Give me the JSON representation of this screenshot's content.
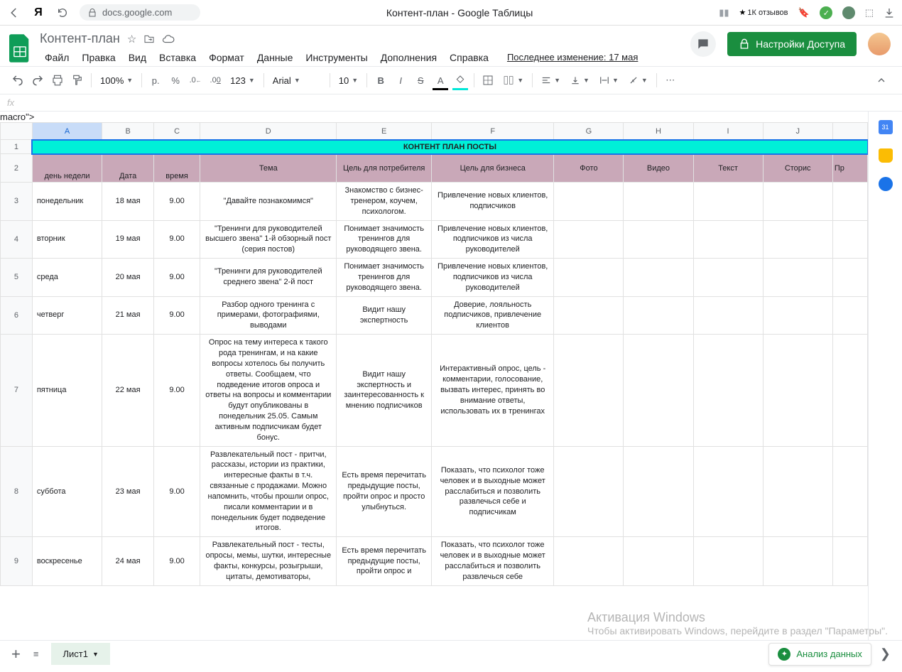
{
  "browser": {
    "url": "docs.google.com",
    "tab_title": "Контент-план - Google Таблицы",
    "reviews": "1К отзывов"
  },
  "doc": {
    "title": "Контент-план",
    "menu": [
      "Файл",
      "Правка",
      "Вид",
      "Вставка",
      "Формат",
      "Данные",
      "Инструменты",
      "Дополнения",
      "Справка"
    ],
    "last_edit": "Последнее изменение: 17 мая",
    "share_label": "Настройки Доступа"
  },
  "toolbar": {
    "zoom": "100%",
    "currency": "р.",
    "percent": "%",
    "dec_dec": ".0",
    "inc_dec": ".00",
    "numfmt": "123",
    "font": "Arial",
    "size": "10"
  },
  "fx": "fx",
  "columns": [
    "A",
    "B",
    "C",
    "D",
    "E",
    "F",
    "G",
    "H",
    "I",
    "J"
  ],
  "extra_col": "Пр",
  "title_row": "КОНТЕНТ ПЛАН ПОСТЫ",
  "headers": [
    "день недели",
    "Дата",
    "время",
    "Тема",
    "Цель для потребителя",
    "Цель для бизнеса",
    "Фото",
    "Видео",
    "Текст",
    "Сторис"
  ],
  "rows": [
    {
      "num": 3,
      "cells": [
        "понедельник",
        "18 мая",
        "9.00",
        "\"Давайте познакомимся\"",
        "Знакомство с бизнес-тренером, коучем, психологом.",
        "Привлечение новых клиентов, подписчиков",
        "",
        "",
        "",
        ""
      ]
    },
    {
      "num": 4,
      "cells": [
        "вторник",
        "19 мая",
        "9.00",
        "\"Тренинги для руководителей высшего звена\" 1-й обзорный пост (серия постов)",
        "Понимает значимость тренингов для руководящего звена.",
        "Привлечение новых клиентов, подписчиков из числа руководителей",
        "",
        "",
        "",
        ""
      ]
    },
    {
      "num": 5,
      "cells": [
        "среда",
        "20 мая",
        "9.00",
        "\"Тренинги для руководителей среднего звена\" 2-й пост",
        "Понимает значимость тренингов для руководящего звена.",
        "Привлечение новых клиентов, подписчиков из числа руководителей",
        "",
        "",
        "",
        ""
      ]
    },
    {
      "num": 6,
      "cells": [
        "четверг",
        "21 мая",
        "9.00",
        "Разбор одного тренинга с примерами, фотографиями, выводами",
        "Видит нашу экспертность",
        "Доверие, лояльность подписчиков, привлечение клиентов",
        "",
        "",
        "",
        ""
      ]
    },
    {
      "num": 7,
      "cells": [
        "пятница",
        "22 мая",
        "9.00",
        "Опрос на тему интереса к такого рода тренингам, и на какие вопросы хотелось бы получить ответы.  Сообщаем, что подведение итогов опроса и ответы на вопросы и комментарии будут опубликованы в понедельник 25.05. Самым активным подписчикам будет бонус.",
        "Видит нашу экспертность и заинтересованность к мнению подписчиков",
        "Интерактивный опрос, цель - комментарии, голосование, вызвать интерес, принять во внимание ответы, использовать их в тренингах",
        "",
        "",
        "",
        ""
      ]
    },
    {
      "num": 8,
      "cells": [
        "суббота",
        "23 мая",
        "9.00",
        "Развлекательный пост - притчи, рассказы, истории из практики, интересные факты в т.ч. связанные с продажами. Можно напомнить, чтобы прошли опрос, писали комментарии и в понедельник будет подведение итогов.",
        "Есть время перечитать предыдущие посты, пройти опрос и просто улыбнуться.",
        "Показать, что психолог тоже человек и в выходные может расслабиться и позволить развлечься себе и подписчикам",
        "",
        "",
        "",
        ""
      ]
    },
    {
      "num": 9,
      "cells": [
        "воскресенье",
        "24 мая",
        "9.00",
        "Развлекательный пост - тесты, опросы, мемы, шутки, интересные факты, конкурсы, розыгрыши, цитаты, демотиваторы,",
        "Есть время перечитать предыдущие посты, пройти опрос и",
        "Показать, что психолог тоже человек и в выходные может расслабиться и позволить развлечься себе",
        "",
        "",
        "",
        ""
      ]
    }
  ],
  "footer": {
    "sheet": "Лист1",
    "explore": "Анализ данных"
  },
  "windows": {
    "line1": "Активация Windows",
    "line2": "Чтобы активировать Windows, перейдите в раздел \"Параметры\"."
  }
}
